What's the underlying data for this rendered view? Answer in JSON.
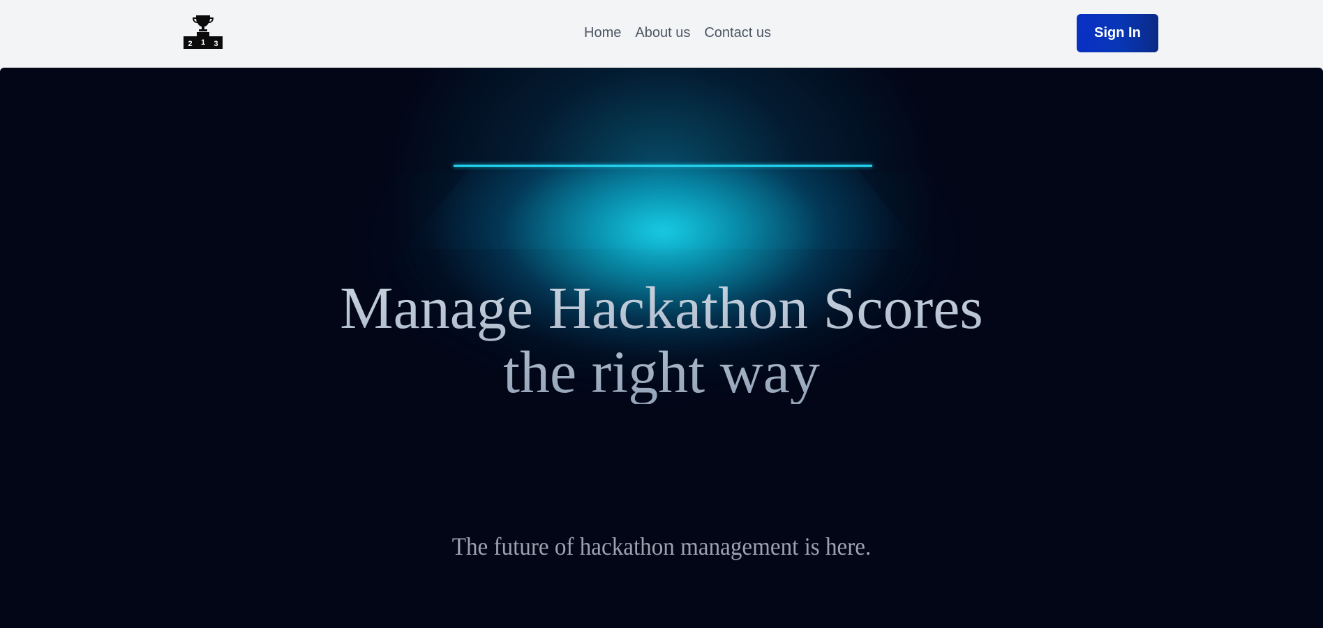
{
  "brand": {
    "logo_icon": "podium-trophy-icon",
    "podium_numbers": [
      "2",
      "1",
      "3"
    ]
  },
  "nav": {
    "links": [
      {
        "label": "Home"
      },
      {
        "label": "About us"
      },
      {
        "label": "Contact us"
      }
    ],
    "signin_label": "Sign In"
  },
  "hero": {
    "title_line1": "Manage Hackathon Scores",
    "title_line2": "the right way",
    "subtitle": "The future of hackathon management is here."
  },
  "colors": {
    "background_dark": "#020617",
    "accent_cyan": "#22d3ee",
    "button_blue": "#0a2fc4",
    "navbar_bg": "#f3f4f6"
  }
}
